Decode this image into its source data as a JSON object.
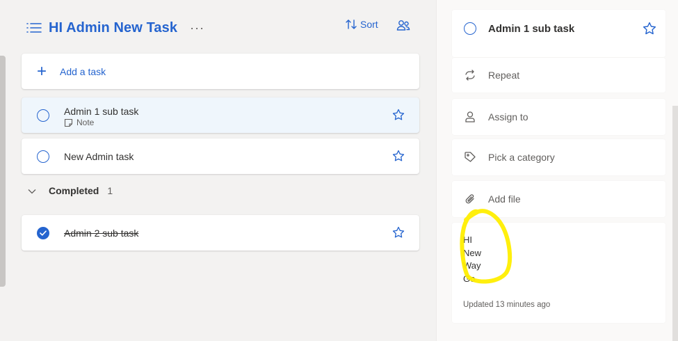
{
  "list": {
    "title": "HI Admin New Task",
    "more_label": "···",
    "sort_label": "Sort",
    "add_task_label": "Add a task",
    "tasks": [
      {
        "title": "Admin 1 sub task",
        "note_label": "Note"
      },
      {
        "title": "New Admin task"
      }
    ],
    "completed_label": "Completed",
    "completed_count": "1",
    "completed_tasks": [
      {
        "title": "Admin 2 sub task"
      }
    ]
  },
  "detail": {
    "title": "Admin 1 sub task",
    "repeat_label": "Repeat",
    "assign_label": "Assign to",
    "category_label": "Pick a category",
    "file_label": "Add file",
    "note_lines": [
      "HI",
      "New",
      "Way",
      "Go"
    ],
    "updated_label": "Updated 13 minutes ago"
  },
  "colors": {
    "accent": "#2564cf",
    "selected_bg": "#eff6fc",
    "highlight": "#ffee00"
  }
}
